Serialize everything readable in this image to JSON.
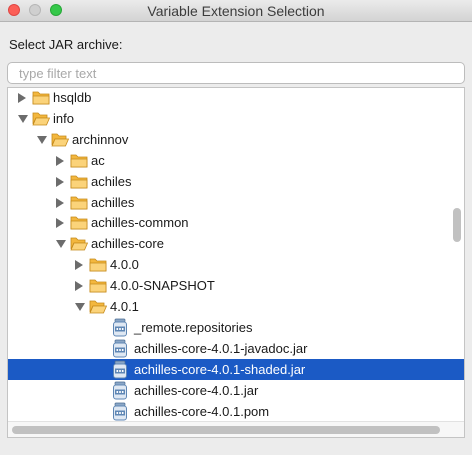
{
  "window": {
    "title": "Variable Extension Selection"
  },
  "prompt": "Select JAR archive:",
  "filter": {
    "placeholder": "type filter text",
    "value": ""
  },
  "colors": {
    "selection": "#1b5ac5",
    "folder": "#f3b73e",
    "jar_icon": "#5e86b4"
  },
  "tree": [
    {
      "label": "hsqldb",
      "level": 0,
      "kind": "folder",
      "state": "collapsed"
    },
    {
      "label": "info",
      "level": 0,
      "kind": "folder",
      "state": "expanded"
    },
    {
      "label": "archinnov",
      "level": 1,
      "kind": "folder",
      "state": "expanded"
    },
    {
      "label": "ac",
      "level": 2,
      "kind": "folder",
      "state": "collapsed"
    },
    {
      "label": "achiles",
      "level": 2,
      "kind": "folder",
      "state": "collapsed"
    },
    {
      "label": "achilles",
      "level": 2,
      "kind": "folder",
      "state": "collapsed"
    },
    {
      "label": "achilles-common",
      "level": 2,
      "kind": "folder",
      "state": "collapsed"
    },
    {
      "label": "achilles-core",
      "level": 2,
      "kind": "folder",
      "state": "expanded"
    },
    {
      "label": "4.0.0",
      "level": 3,
      "kind": "folder",
      "state": "collapsed"
    },
    {
      "label": "4.0.0-SNAPSHOT",
      "level": 3,
      "kind": "folder",
      "state": "collapsed"
    },
    {
      "label": "4.0.1",
      "level": 3,
      "kind": "folder",
      "state": "expanded"
    },
    {
      "label": "_remote.repositories",
      "level": 4,
      "kind": "file"
    },
    {
      "label": "achilles-core-4.0.1-javadoc.jar",
      "level": 4,
      "kind": "file"
    },
    {
      "label": "achilles-core-4.0.1-shaded.jar",
      "level": 4,
      "kind": "file",
      "selected": true
    },
    {
      "label": "achilles-core-4.0.1.jar",
      "level": 4,
      "kind": "file"
    },
    {
      "label": "achilles-core-4.0.1.pom",
      "level": 4,
      "kind": "file"
    }
  ]
}
